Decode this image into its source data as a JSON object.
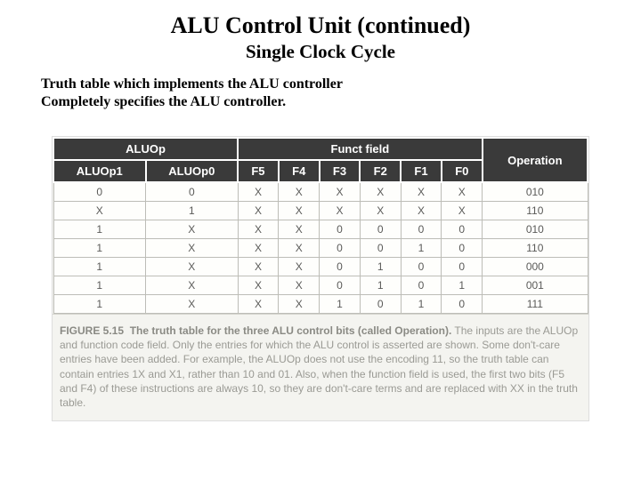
{
  "title": "ALU Control Unit (continued)",
  "subtitle": "Single Clock Cycle",
  "description_line1": "Truth table which implements the ALU controller",
  "description_line2": "Completely specifies the ALU controller.",
  "table": {
    "group_headers": {
      "aluop": "ALUOp",
      "funct": "Funct field",
      "operation": "Operation"
    },
    "col_headers": {
      "aluop1": "ALUOp1",
      "aluop0": "ALUOp0",
      "f5": "F5",
      "f4": "F4",
      "f3": "F3",
      "f2": "F2",
      "f1": "F1",
      "f0": "F0"
    },
    "rows": [
      {
        "aluop1": "0",
        "aluop0": "0",
        "f5": "X",
        "f4": "X",
        "f3": "X",
        "f2": "X",
        "f1": "X",
        "f0": "X",
        "op": "010"
      },
      {
        "aluop1": "X",
        "aluop0": "1",
        "f5": "X",
        "f4": "X",
        "f3": "X",
        "f2": "X",
        "f1": "X",
        "f0": "X",
        "op": "110"
      },
      {
        "aluop1": "1",
        "aluop0": "X",
        "f5": "X",
        "f4": "X",
        "f3": "0",
        "f2": "0",
        "f1": "0",
        "f0": "0",
        "op": "010"
      },
      {
        "aluop1": "1",
        "aluop0": "X",
        "f5": "X",
        "f4": "X",
        "f3": "0",
        "f2": "0",
        "f1": "1",
        "f0": "0",
        "op": "110"
      },
      {
        "aluop1": "1",
        "aluop0": "X",
        "f5": "X",
        "f4": "X",
        "f3": "0",
        "f2": "1",
        "f1": "0",
        "f0": "0",
        "op": "000"
      },
      {
        "aluop1": "1",
        "aluop0": "X",
        "f5": "X",
        "f4": "X",
        "f3": "0",
        "f2": "1",
        "f1": "0",
        "f0": "1",
        "op": "001"
      },
      {
        "aluop1": "1",
        "aluop0": "X",
        "f5": "X",
        "f4": "X",
        "f3": "1",
        "f2": "0",
        "f1": "1",
        "f0": "0",
        "op": "111"
      }
    ]
  },
  "caption": {
    "figno": "FIGURE 5.15",
    "figtitle": "The truth table for the three ALU control bits (called Operation).",
    "body": " The inputs are the ALUOp and function code field. Only the entries for which the ALU control is asserted are shown. Some don't-care entries have been added. For example, the ALUOp does not use the encoding 11, so the truth table can contain entries 1X and X1, rather than 10 and 01. Also, when the function field is used, the first two bits (F5 and F4) of these instructions are always 10, so they are don't-care terms and are replaced with XX in the truth table."
  }
}
